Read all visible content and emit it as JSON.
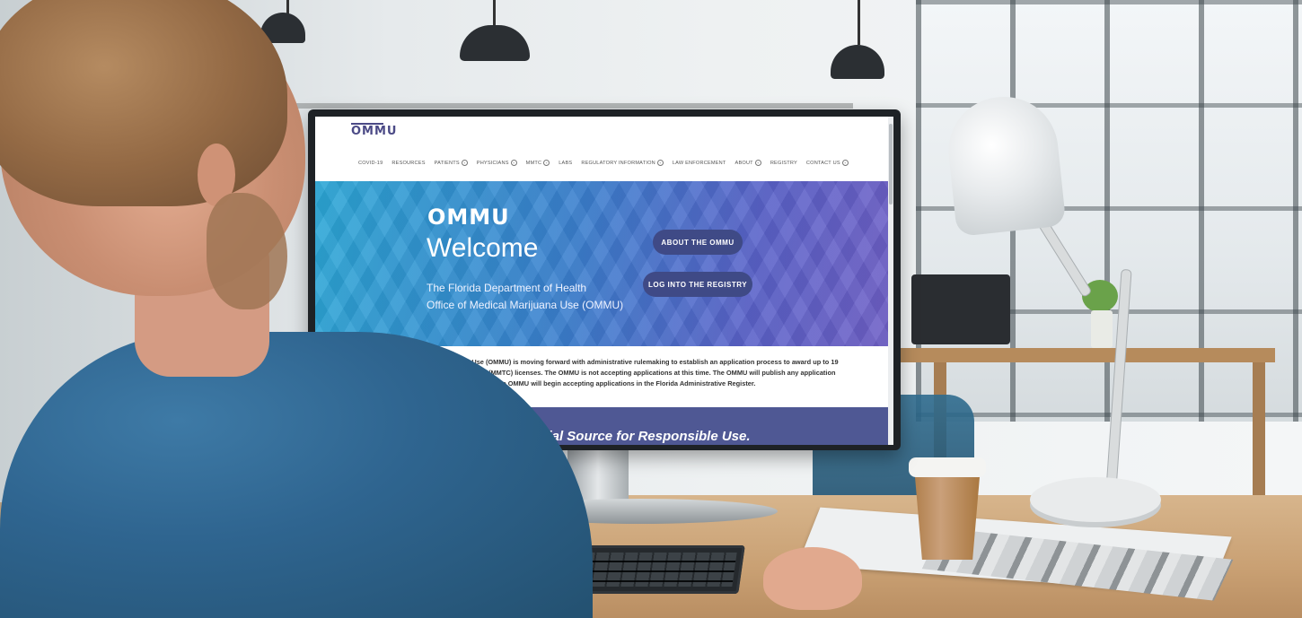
{
  "site": {
    "brand": "OMMU",
    "nav": [
      {
        "label": "COVID-19",
        "has_plus": false
      },
      {
        "label": "RESOURCES",
        "has_plus": false
      },
      {
        "label": "PATIENTS",
        "has_plus": true
      },
      {
        "label": "PHYSICIANS",
        "has_plus": true
      },
      {
        "label": "MMTC",
        "has_plus": true
      },
      {
        "label": "LABS",
        "has_plus": false
      },
      {
        "label": "REGULATORY INFORMATION",
        "has_plus": true
      },
      {
        "label": "LAW ENFORCEMENT",
        "has_plus": false
      },
      {
        "label": "ABOUT",
        "has_plus": true
      },
      {
        "label": "REGISTRY",
        "has_plus": false
      },
      {
        "label": "CONTACT US",
        "has_plus": true
      }
    ],
    "hero": {
      "brand": "OMMU",
      "title": "Welcome",
      "subtitle_line1": "The Florida Department of Health",
      "subtitle_line2": "Office of Medical Marijuana Use (OMMU)",
      "about_button": "ABOUT THE OMMU",
      "registry_button": "LOG INTO THE REGISTRY"
    },
    "notice": "The Office of Medical Marijuana Use (OMMU) is moving forward with administrative rulemaking to establish an application process to award up to 19 Medical Marijuana Treatment Center (MMTC) licenses. The OMMU is not accepting applications at this time. The OMMU will publish any application rule and date the OMMU will begin accepting applications in the Florida Administrative Register.",
    "tagline": "Florida's Official Source for Responsible Use."
  },
  "colors": {
    "brand_purple": "#4b4a86",
    "button_bg": "#3f4a86",
    "band_bg": "#4f5894"
  }
}
